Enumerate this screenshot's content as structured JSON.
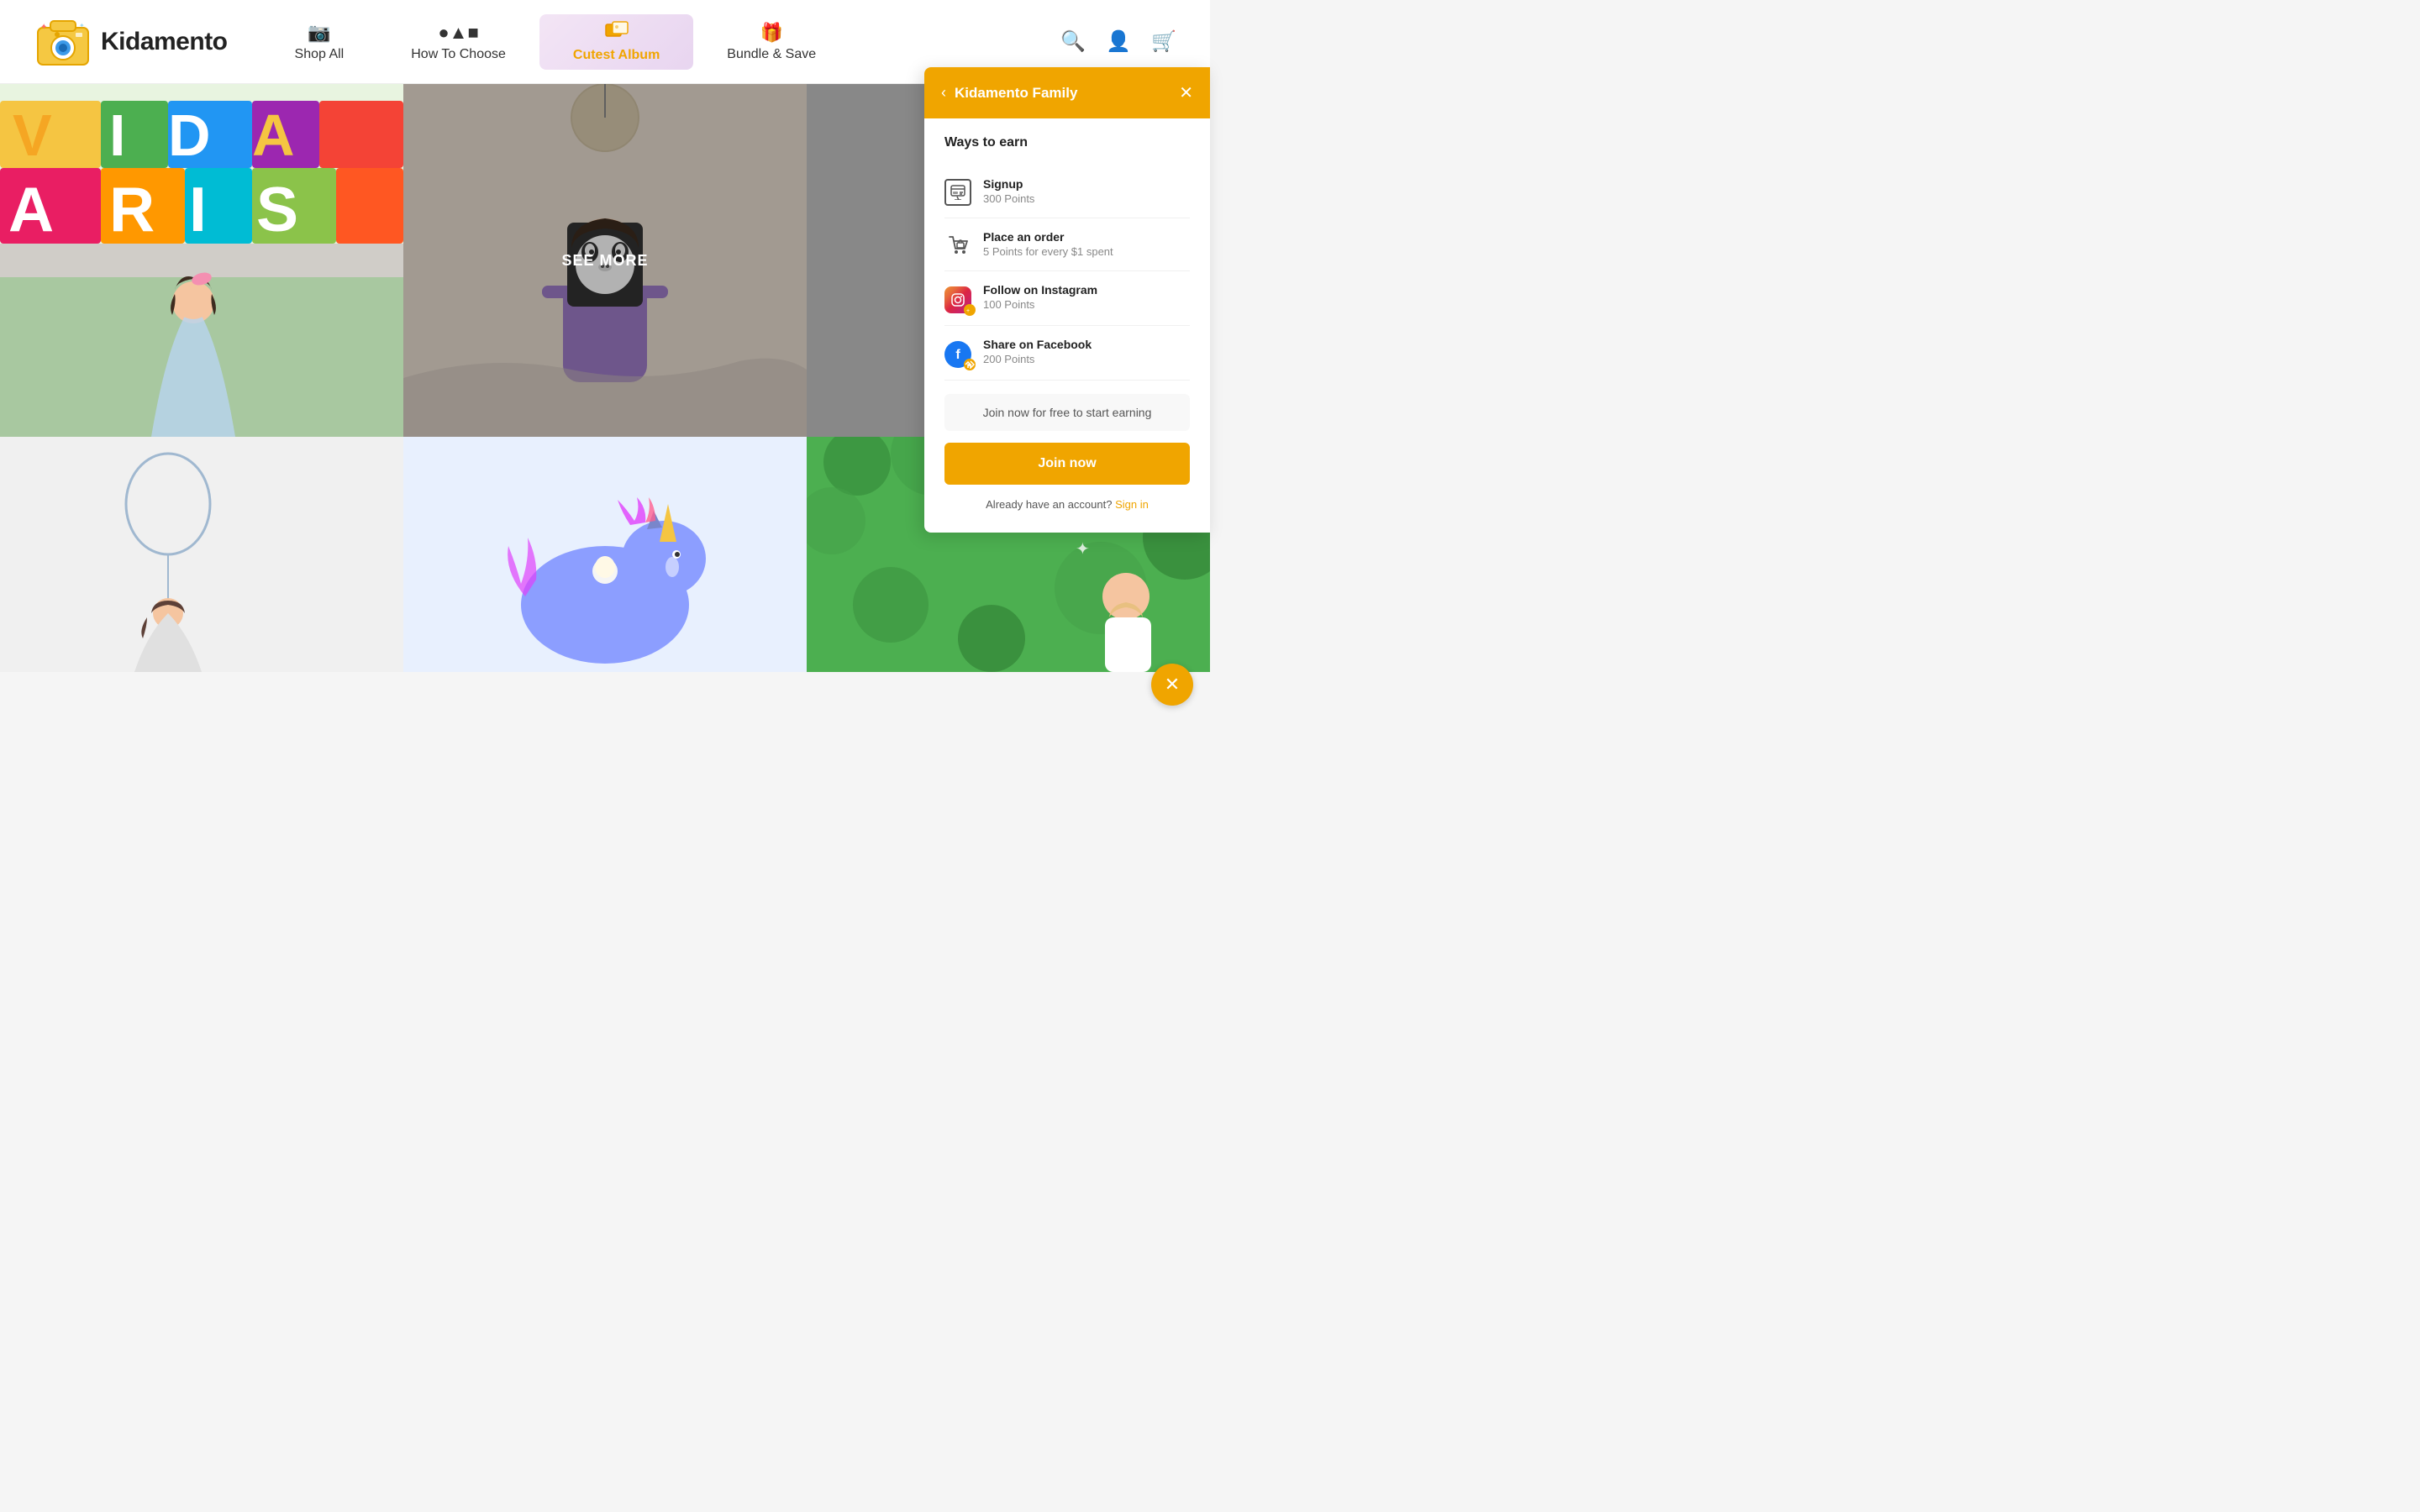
{
  "navbar": {
    "logo_text": "Kidamento",
    "nav_items": [
      {
        "id": "shop-all",
        "label": "Shop All",
        "icon": "📷",
        "active": false
      },
      {
        "id": "how-to-choose",
        "label": "How To Choose",
        "icon": "◼▲◼",
        "active": false
      },
      {
        "id": "cutest-album",
        "label": "Cutest Album",
        "icon": "🖼️",
        "active": true
      },
      {
        "id": "bundle-save",
        "label": "Bundle & Save",
        "icon": "🎁",
        "active": false
      }
    ],
    "icons": {
      "search": "🔍",
      "user": "👤",
      "cart": "🛒"
    }
  },
  "photo_grid": {
    "see_more_label": "SEE MORE"
  },
  "reward_panel": {
    "title": "Kidamento Family",
    "ways_to_earn_heading": "Ways to earn",
    "earn_items": [
      {
        "id": "signup",
        "label": "Signup",
        "points": "300 Points"
      },
      {
        "id": "place-order",
        "label": "Place an order",
        "points": "5 Points for every $1 spent"
      },
      {
        "id": "instagram",
        "label": "Follow on Instagram",
        "points": "100 Points"
      },
      {
        "id": "facebook",
        "label": "Share on Facebook",
        "points": "200 Points"
      }
    ],
    "join_promo_text": "Join now for free to start earning",
    "join_btn_label": "Join now",
    "already_account_text": "Already have an account?",
    "sign_in_label": "Sign in"
  },
  "colors": {
    "brand_orange": "#f0a500",
    "brand_blue": "#1877f2",
    "brand_instagram": "#dc2743"
  }
}
